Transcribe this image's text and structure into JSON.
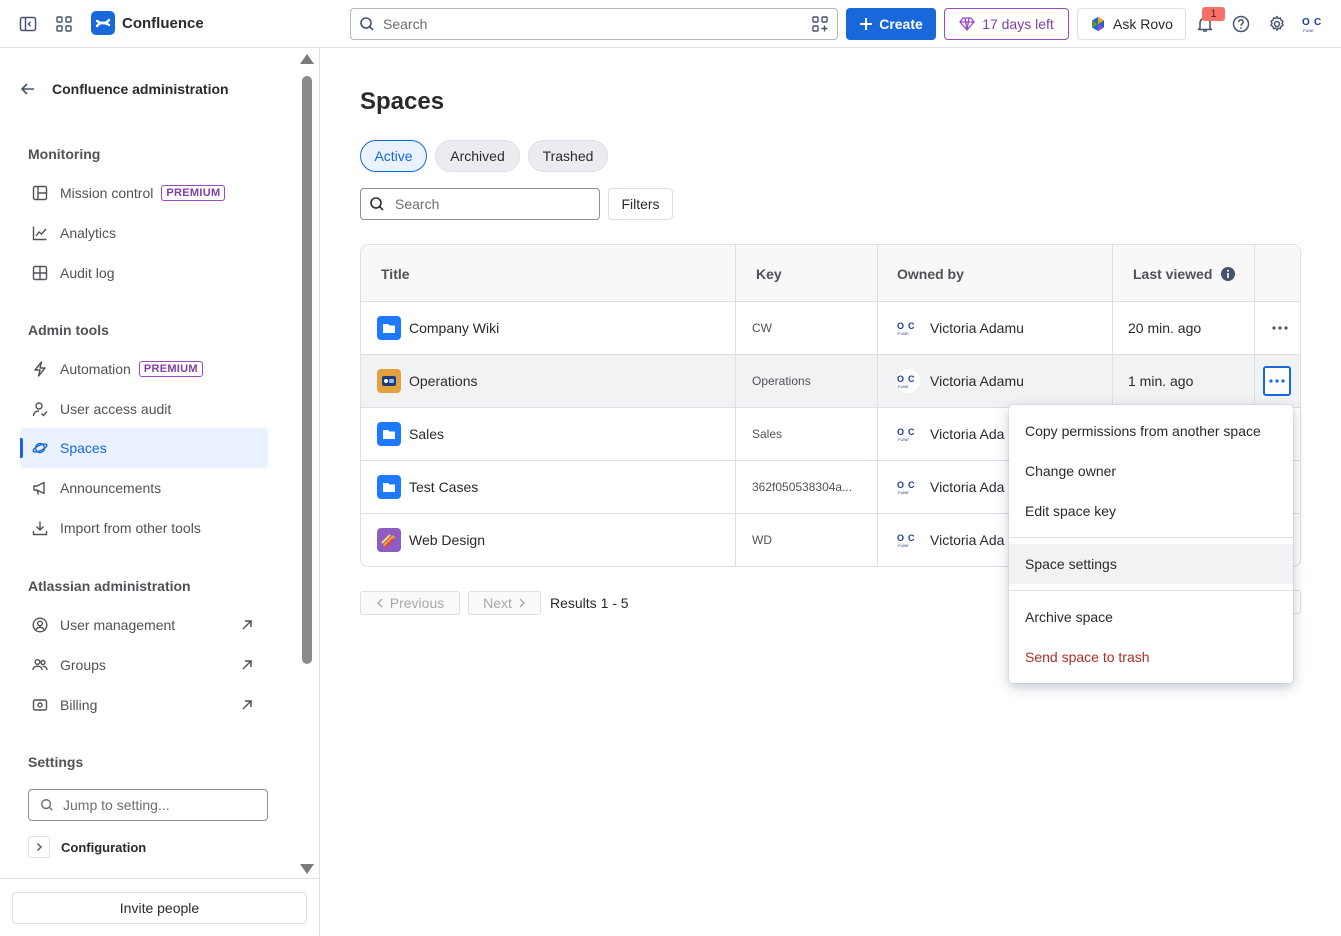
{
  "topbar": {
    "app_name": "Confluence",
    "search_placeholder": "Search",
    "create_label": "Create",
    "trial_label": "17 days left",
    "rovo_label": "Ask Rovo",
    "notification_count": "1",
    "accent": "#1868db"
  },
  "sidebar": {
    "back_title": "Confluence administration",
    "sections": {
      "monitoring": "Monitoring",
      "admin_tools": "Admin tools",
      "atlassian_admin": "Atlassian administration",
      "settings": "Settings"
    },
    "premium_badge": "PREMIUM",
    "items": {
      "mission_control": "Mission control",
      "analytics": "Analytics",
      "audit_log": "Audit log",
      "automation": "Automation",
      "user_access_audit": "User access audit",
      "spaces": "Spaces",
      "announcements": "Announcements",
      "import": "Import from other tools",
      "user_management": "User management",
      "groups": "Groups",
      "billing": "Billing"
    },
    "jump_placeholder": "Jump to setting...",
    "configuration": "Configuration",
    "invite_label": "Invite people"
  },
  "main": {
    "title": "Spaces",
    "tabs": [
      "Active",
      "Archived",
      "Trashed"
    ],
    "search_placeholder": "Search",
    "filters_label": "Filters",
    "columns": [
      "Title",
      "Key",
      "Owned by",
      "Last viewed"
    ],
    "rows": [
      {
        "title": "Company Wiki",
        "key": "CW",
        "owner": "Victoria Adamu",
        "last_viewed": "20 min. ago",
        "icon_color": "#1d7afc"
      },
      {
        "title": "Operations",
        "key": "Operations",
        "owner": "Victoria Adamu",
        "last_viewed": "1 min. ago",
        "icon_color": "#e2a03f"
      },
      {
        "title": "Sales",
        "key": "Sales",
        "owner": "Victoria Ada",
        "last_viewed": "",
        "icon_color": "#1d7afc"
      },
      {
        "title": "Test Cases",
        "key": "362f050538304a...",
        "owner": "Victoria Ada",
        "last_viewed": "",
        "icon_color": "#1d7afc"
      },
      {
        "title": "Web Design",
        "key": "WD",
        "owner": "Victoria Ada",
        "last_viewed": "",
        "icon_color": "#8f5cc4"
      }
    ],
    "pager": {
      "previous": "Previous",
      "next": "Next",
      "results": "Results 1 - 5"
    }
  },
  "context_menu": {
    "items": [
      "Copy permissions from another space",
      "Change owner",
      "Edit space key",
      "Space settings",
      "Archive space",
      "Send space to trash"
    ],
    "danger_color": "#ae2e24"
  }
}
